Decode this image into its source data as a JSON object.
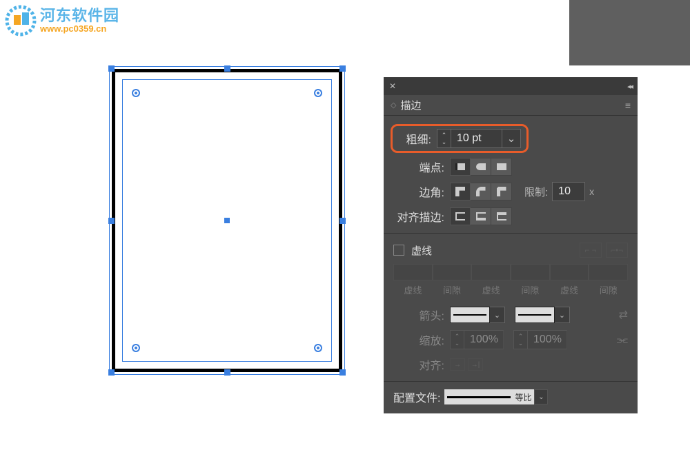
{
  "watermark": {
    "site_name_cn": "河东软件园",
    "site_url": "www.pc0359.cn"
  },
  "panel": {
    "title": "描边",
    "weight": {
      "label": "粗细:",
      "value": "10 pt"
    },
    "cap": {
      "label": "端点:"
    },
    "corner": {
      "label": "边角:",
      "limit_label": "限制:",
      "limit_value": "10",
      "limit_suffix": "x"
    },
    "align": {
      "label": "对齐描边:"
    },
    "dashed": {
      "label": "虚线",
      "columns": [
        "虚线",
        "间隙",
        "虚线",
        "间隙",
        "虚线",
        "间隙"
      ]
    },
    "arrow": {
      "label": "箭头:"
    },
    "scale": {
      "label": "缩放:",
      "value1": "100%",
      "value2": "100%"
    },
    "arrow_align": {
      "label": "对齐:"
    },
    "profile": {
      "label": "配置文件:",
      "swatch_text": "等比"
    }
  }
}
